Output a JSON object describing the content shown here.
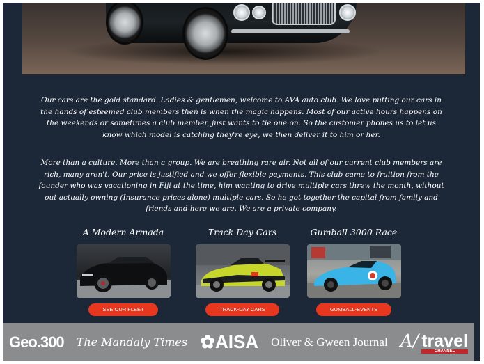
{
  "intro": {
    "paragraph1": "Our cars are the gold standard. Ladies & gentlemen, welcome to AVA auto club. We love putting our cars in the hands of esteemed club members then is when the magic happens. Most of our active hours happens on the weekends or sometimes a club member, just wants to tie one on. So the customer phones us to let us know which model is catching they're eye, we then deliver it to him or her.",
    "paragraph2": "More than a culture. More than a group. We are breathing rare air. Not all of our current club members are rich, many aren't. Our price is justified and we offer flexible payments. This club came to fruition from the founder who was vacationing in Fiji at the time, him wanting to drive multiple cars threw the month, without out actually owning (Insurance prices alone) multiple cars. So he got together the capital from family and friends and here we are. We are a private company."
  },
  "cards": [
    {
      "title": "A Modern Armada",
      "button": "SEE OUR FLEET"
    },
    {
      "title": "Track Day Cars",
      "button": "TRACK-DAY CARS"
    },
    {
      "title": "Gumball 3000 Race",
      "button": "GUMBALL-EVENTS"
    }
  ],
  "press_logos": {
    "geo": "Geo.300",
    "mandaly": "The Mandaly Times",
    "aisa": "AISA",
    "oliver": "Oliver & Gween Journal",
    "travel_initials": "A/",
    "travel": "travel",
    "travel_sub": "CHANNEL"
  },
  "colors": {
    "page_background": "#1c2838",
    "button": "#e8371f",
    "logo_strip": "#8a8c8e"
  }
}
